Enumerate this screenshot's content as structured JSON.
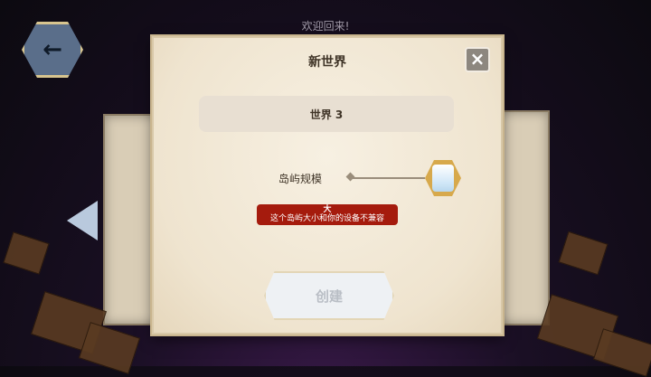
{
  "header": {
    "welcome_text": "欢迎回来!"
  },
  "dialog": {
    "title": "新世界",
    "world_name": "世界 3",
    "size_label": "岛屿规模",
    "size_value": "大",
    "warning": "这个岛屿大小和你的设备不兼容",
    "create_label": "创建"
  },
  "icons": {
    "back": "arrow-left-icon",
    "close": "close-icon",
    "prev": "triangle-left-icon"
  },
  "colors": {
    "warning_bg": "#a51b0d",
    "slider_knob": "#d7a94c",
    "back_button": "#5a6e8a"
  }
}
